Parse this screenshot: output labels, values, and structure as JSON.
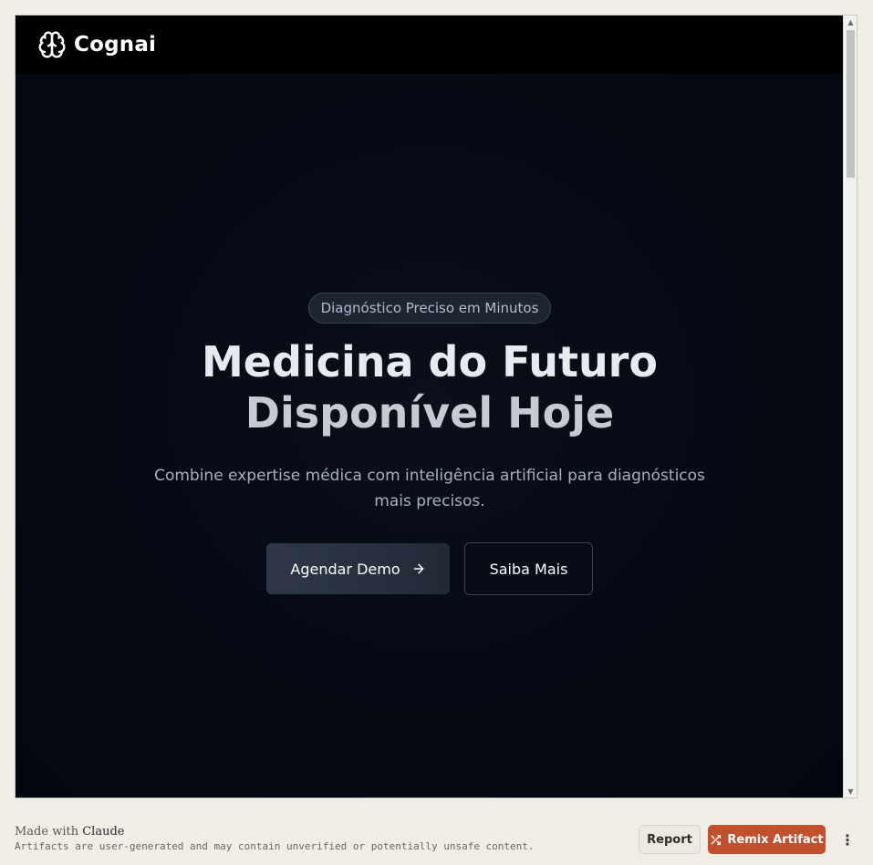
{
  "app": {
    "brand_name": "Cognai",
    "brand_icon": "brain-icon"
  },
  "hero": {
    "badge": "Diagnóstico Preciso em Minutos",
    "headline_line1": "Medicina do Futuro",
    "headline_line2": "Disponível Hoje",
    "subtitle": "Combine expertise médica com inteligência artificial para diagnósticos mais precisos.",
    "primary_button": "Agendar Demo",
    "primary_button_icon": "arrow-right-icon",
    "secondary_button": "Saiba Mais"
  },
  "footer": {
    "made_with_prefix": "Made with",
    "made_with_brand": "Claude",
    "disclaimer": "Artifacts are user-generated and may contain unverified or potentially unsafe content.",
    "report_label": "Report",
    "remix_label": "Remix Artifact",
    "remix_icon": "shuffle-icon",
    "more_icon": "more-vertical-icon"
  },
  "colors": {
    "page_background": "#050811",
    "navbar_background": "#000000",
    "remix_accent": "#c2502f",
    "footer_background": "#efede6"
  }
}
